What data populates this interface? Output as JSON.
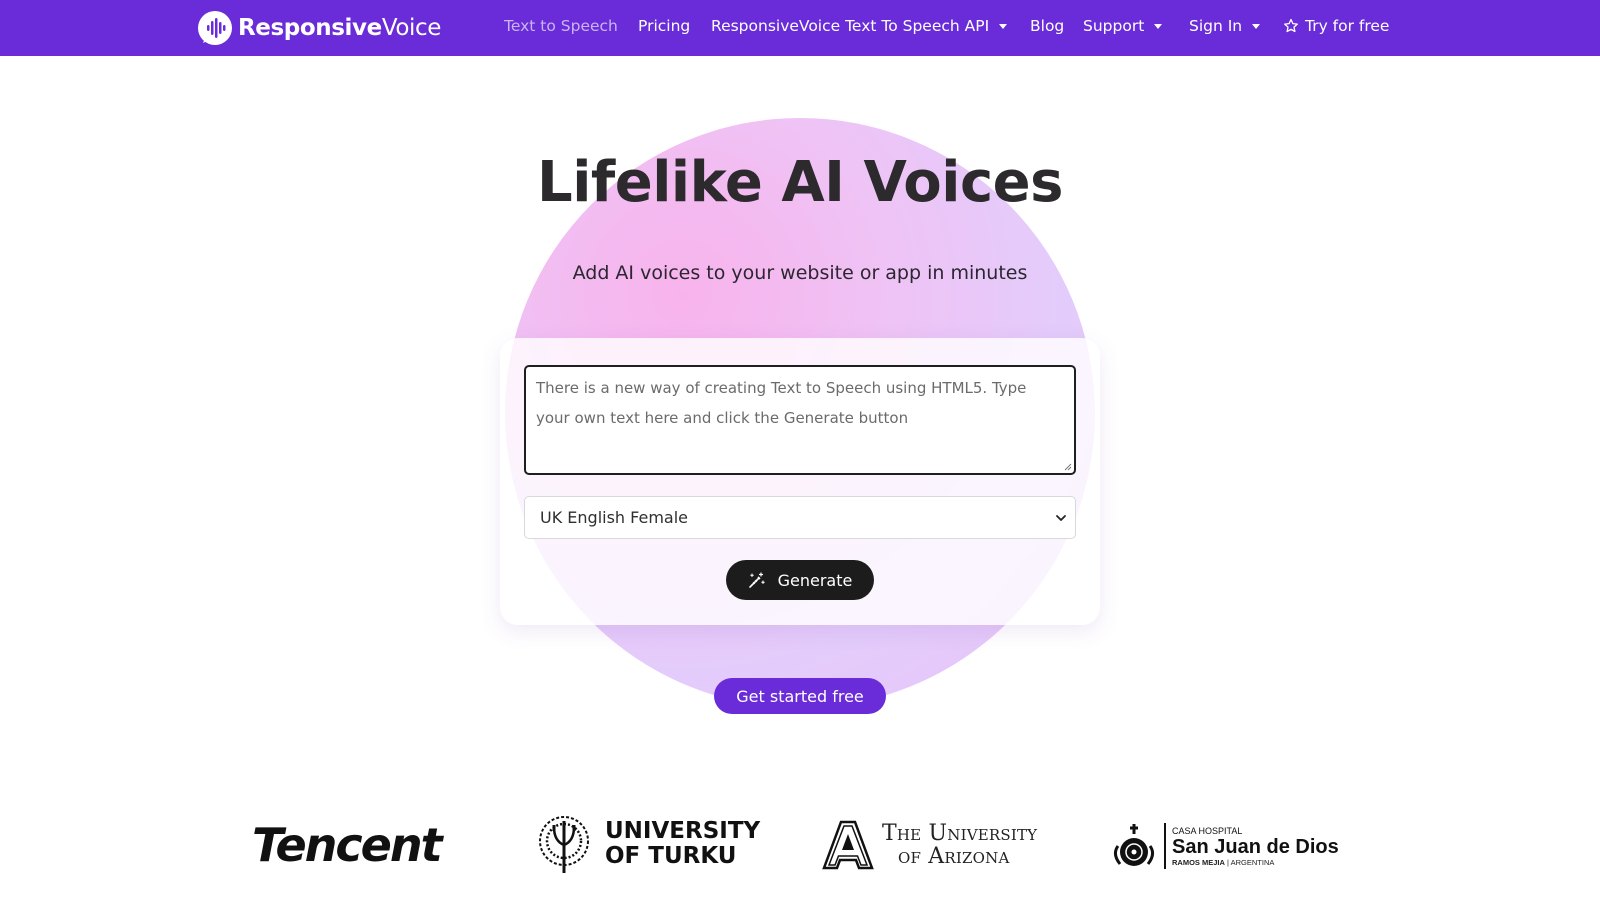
{
  "nav": {
    "logo_bold": "Responsive",
    "logo_light": "Voice",
    "items": [
      {
        "label": "Text to Speech",
        "active": true
      },
      {
        "label": "Pricing"
      },
      {
        "label": "ResponsiveVoice Text To Speech API",
        "dropdown": true
      },
      {
        "label": "Blog"
      },
      {
        "label": "Support",
        "dropdown": true
      },
      {
        "label": "Sign In",
        "dropdown": true
      },
      {
        "label": "Try for free",
        "icon": "star-icon"
      }
    ]
  },
  "hero": {
    "title": "Lifelike AI Voices",
    "subtitle": "Add AI voices to your website or app in minutes"
  },
  "demo": {
    "textarea_value": "There is a new way of creating Text to Speech using HTML5. Type your own text here and click the Generate button",
    "voice_selected": "UK English Female",
    "generate_label": "Generate",
    "generate_icon": "magic-wand-icon"
  },
  "cta": {
    "label": "Get started free"
  },
  "logos": {
    "tencent": "Tencent",
    "turku_line1": "UNIVERSITY",
    "turku_line2": "OF TURKU",
    "arizona_line1": "The University",
    "arizona_line2": "of Arizona",
    "sanjuan_top": "CASA HOSPITAL",
    "sanjuan_main": "San Juan de Dios",
    "sanjuan_loc_bold": "RAMOS MEJIA",
    "sanjuan_loc": "| ARGENTINA"
  },
  "colors": {
    "brand_purple": "#6a2bd9",
    "button_dark": "#1c1c1c",
    "blob_pink": "#f8b3ec",
    "blob_lavender": "#e3ccfb"
  }
}
